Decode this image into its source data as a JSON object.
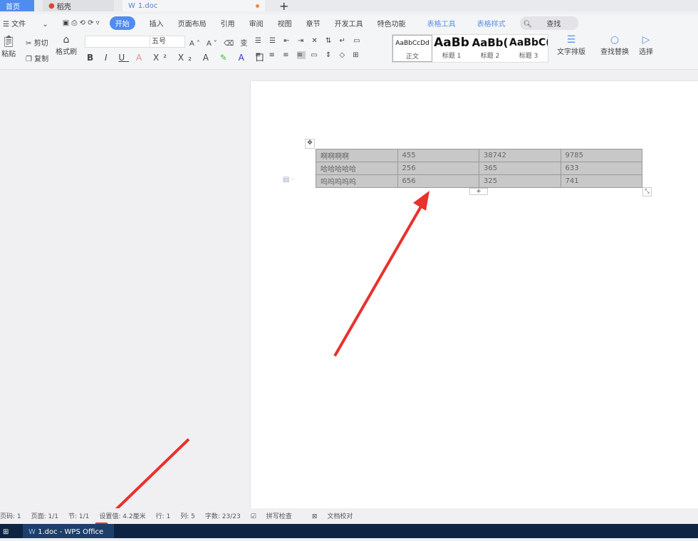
{
  "tabs": {
    "home": "首页",
    "daoke": "稻壳",
    "doc": "1.doc"
  },
  "menu": {
    "file": "文件",
    "items": [
      "开始",
      "插入",
      "页面布局",
      "引用",
      "审阅",
      "视图",
      "章节",
      "开发工具",
      "特色功能"
    ],
    "table_tools": "表格工具",
    "table_style": "表格样式",
    "search": "查找"
  },
  "ribbon": {
    "paste": "粘贴",
    "cut": "剪切",
    "copy": "复制",
    "format_painter": "格式刷",
    "font_name": "",
    "font_size": "五号",
    "styles": [
      {
        "preview": "AaBbCcDd",
        "label": "正文"
      },
      {
        "preview": "AaBb",
        "label": "标题 1"
      },
      {
        "preview": "AaBb(",
        "label": "标题 2"
      },
      {
        "preview": "AaBbC(",
        "label": "标题 3"
      }
    ],
    "text_layout": "文字排版",
    "find_replace": "查找替换",
    "select": "选择"
  },
  "table": {
    "rows": [
      [
        "啊啊啊啊",
        "455",
        "38742",
        "9785"
      ],
      [
        "哈哈哈哈哈",
        "256",
        "365",
        "633"
      ],
      [
        "呜呜呜呜呜",
        "656",
        "325",
        "741"
      ]
    ]
  },
  "status": {
    "page_num": "页码: 1",
    "pages": "页面: 1/1",
    "section": "节: 1/1",
    "setting": "设置值: 4.2厘米",
    "row": "行: 1",
    "col": "列: 5",
    "words": "字数: 23/23",
    "spell": "拼写检查",
    "proof": "文档校对"
  },
  "taskbar": {
    "app": "1.doc - WPS Office"
  },
  "colors": {
    "accent": "#4f8cf0",
    "arrow": "#e8322e",
    "taskbar": "#0d2542"
  }
}
